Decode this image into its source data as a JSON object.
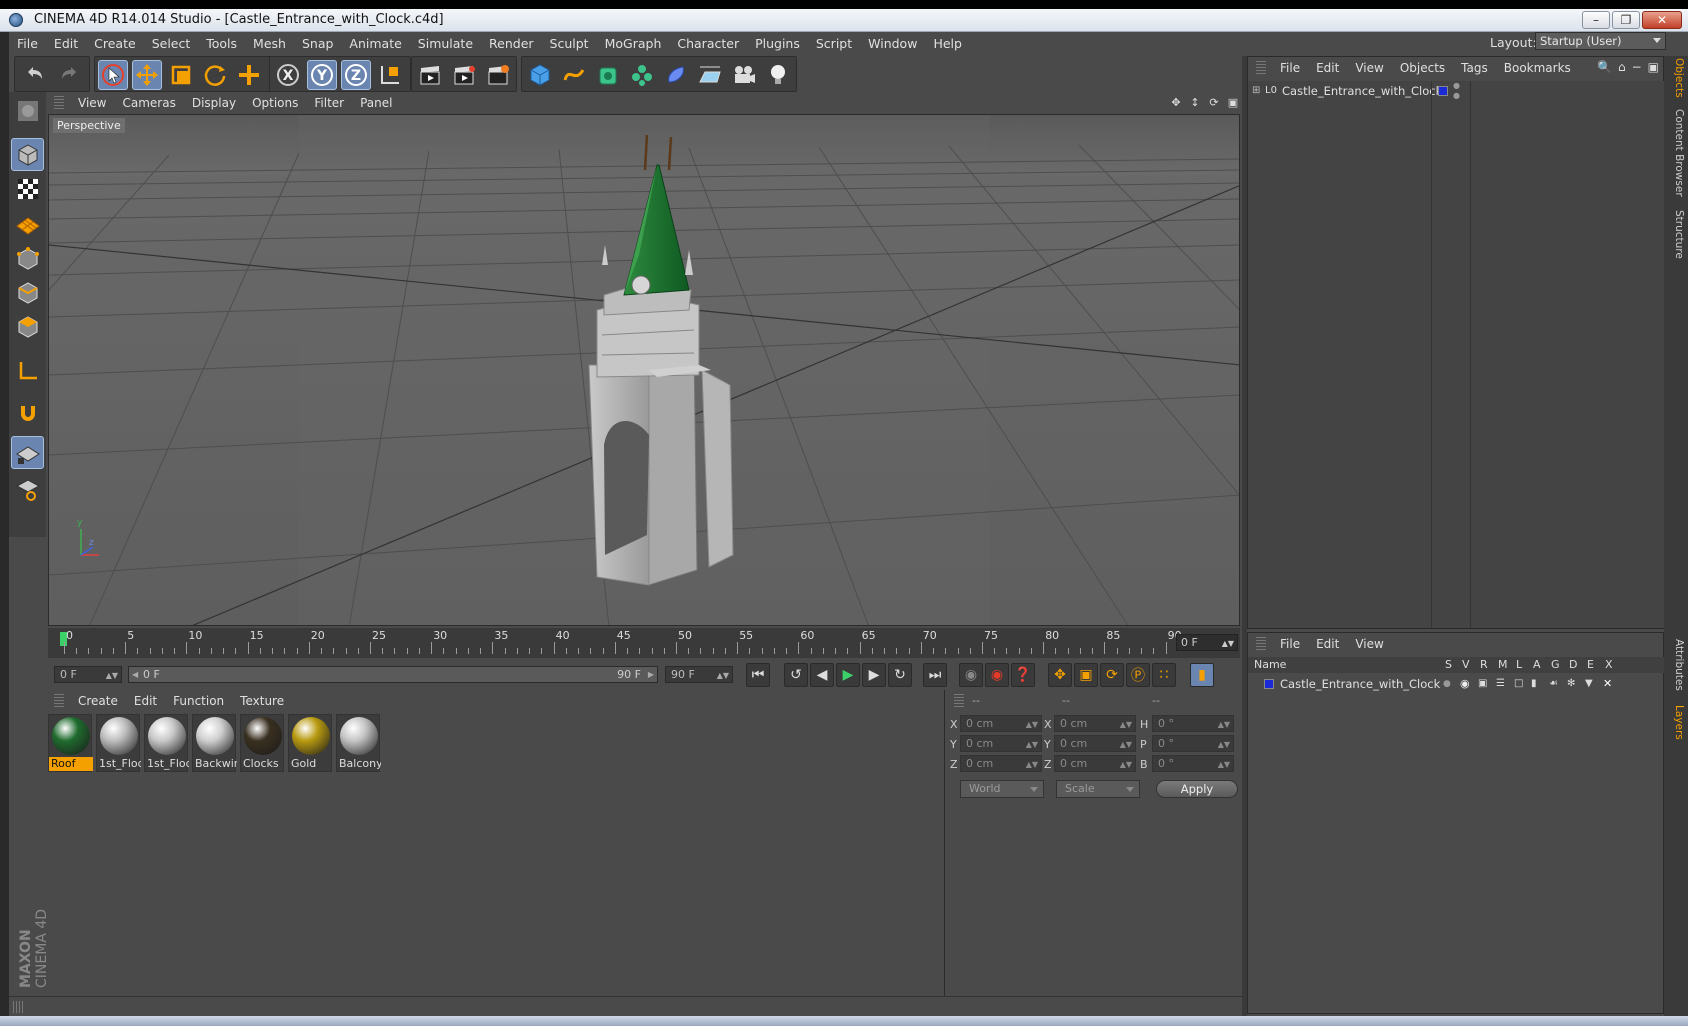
{
  "window": {
    "title": "CINEMA 4D R14.014 Studio - [Castle_Entrance_with_Clock.c4d]"
  },
  "menu": [
    "File",
    "Edit",
    "Create",
    "Select",
    "Tools",
    "Mesh",
    "Snap",
    "Animate",
    "Simulate",
    "Render",
    "Sculpt",
    "MoGraph",
    "Character",
    "Plugins",
    "Script",
    "Window",
    "Help"
  ],
  "layout": {
    "label": "Layout:",
    "value": "Startup (User)"
  },
  "viewport": {
    "menu": [
      "View",
      "Cameras",
      "Display",
      "Options",
      "Filter",
      "Panel"
    ],
    "label": "Perspective"
  },
  "timeline": {
    "ticks": [
      "0",
      "5",
      "10",
      "15",
      "20",
      "25",
      "30",
      "35",
      "40",
      "45",
      "50",
      "55",
      "60",
      "65",
      "70",
      "75",
      "80",
      "85",
      "90"
    ],
    "current_frame": "0 F"
  },
  "transport": {
    "start": "0 F",
    "slider_left": "0 F",
    "slider_right": "90 F",
    "end": "90 F"
  },
  "materials": {
    "menu": [
      "Create",
      "Edit",
      "Function",
      "Texture"
    ],
    "items": [
      {
        "label": "Roof",
        "color": "#1f6b2e"
      },
      {
        "label": "1st_Floc",
        "color": "#bdbdbd"
      },
      {
        "label": "1st_Floc",
        "color": "#c8c8c8"
      },
      {
        "label": "Backwin",
        "color": "#cfcfcf"
      },
      {
        "label": "Clocks",
        "color": "#3a3020"
      },
      {
        "label": "Gold",
        "color": "#b89a10"
      },
      {
        "label": "Balcony",
        "color": "#c4c4c4"
      }
    ]
  },
  "coords": {
    "headers": [
      "--",
      "--",
      "--"
    ],
    "rows": [
      {
        "a": "X",
        "av": "0 cm",
        "b": "X",
        "bv": "0 cm",
        "c": "H",
        "cv": "0 °"
      },
      {
        "a": "Y",
        "av": "0 cm",
        "b": "Y",
        "bv": "0 cm",
        "c": "P",
        "cv": "0 °"
      },
      {
        "a": "Z",
        "av": "0 cm",
        "b": "Z",
        "bv": "0 cm",
        "c": "B",
        "cv": "0 °"
      }
    ],
    "mode": "World",
    "scale": "Scale",
    "apply": "Apply"
  },
  "objects": {
    "menu": [
      "File",
      "Edit",
      "View",
      "Objects",
      "Tags",
      "Bookmarks"
    ],
    "items": [
      {
        "name": "Castle_Entrance_with_Clock"
      }
    ]
  },
  "layers": {
    "menu": [
      "File",
      "Edit",
      "View"
    ],
    "columns": {
      "name": "Name",
      "flags": [
        "S",
        "V",
        "R",
        "M",
        "L",
        "A",
        "G",
        "D",
        "E",
        "X"
      ]
    },
    "items": [
      {
        "name": "Castle_Entrance_with_Clock"
      }
    ]
  },
  "side_tabs": [
    "Objects",
    "Content Browser",
    "Structure",
    "Attributes",
    "Layers"
  ],
  "brand": {
    "maxon": "MAXON",
    "product": "CINEMA 4D"
  },
  "colors": {
    "accent": "#f4a000",
    "selected_tool": "#6a86b0",
    "layer_color": "#1a2bd6"
  }
}
